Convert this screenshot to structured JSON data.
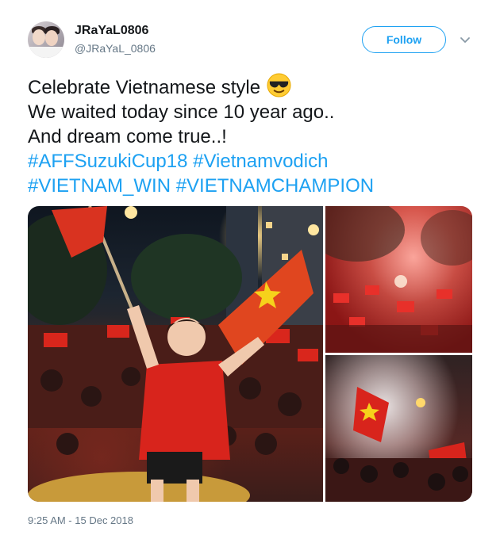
{
  "user": {
    "display_name": "JRaYaL0806",
    "handle": "@JRaYaL_0806"
  },
  "follow_button": {
    "label": "Follow"
  },
  "tweet": {
    "line1": "Celebrate Vietnamese style",
    "line1_emoji": "sunglasses-face-emoji",
    "line2": "We waited today since 10 year ago..",
    "line3": "And dream come true..!",
    "hashtags_line1": [
      "#AFFSuzukiCup18",
      "#Vietnamvodich"
    ],
    "hashtags_line2": [
      "#VIETNAM_WIN",
      "#VIETNAMCHAMPION"
    ]
  },
  "media": {
    "photo_main": "street-celebration-photo",
    "photo_top": "crowd-flares-photo",
    "photo_bottom": "crowd-flags-smoke-photo"
  },
  "timestamp": "9:25 AM - 15 Dec 2018",
  "colors": {
    "accent": "#1da1f2",
    "text": "#14171a",
    "muted": "#657786"
  }
}
